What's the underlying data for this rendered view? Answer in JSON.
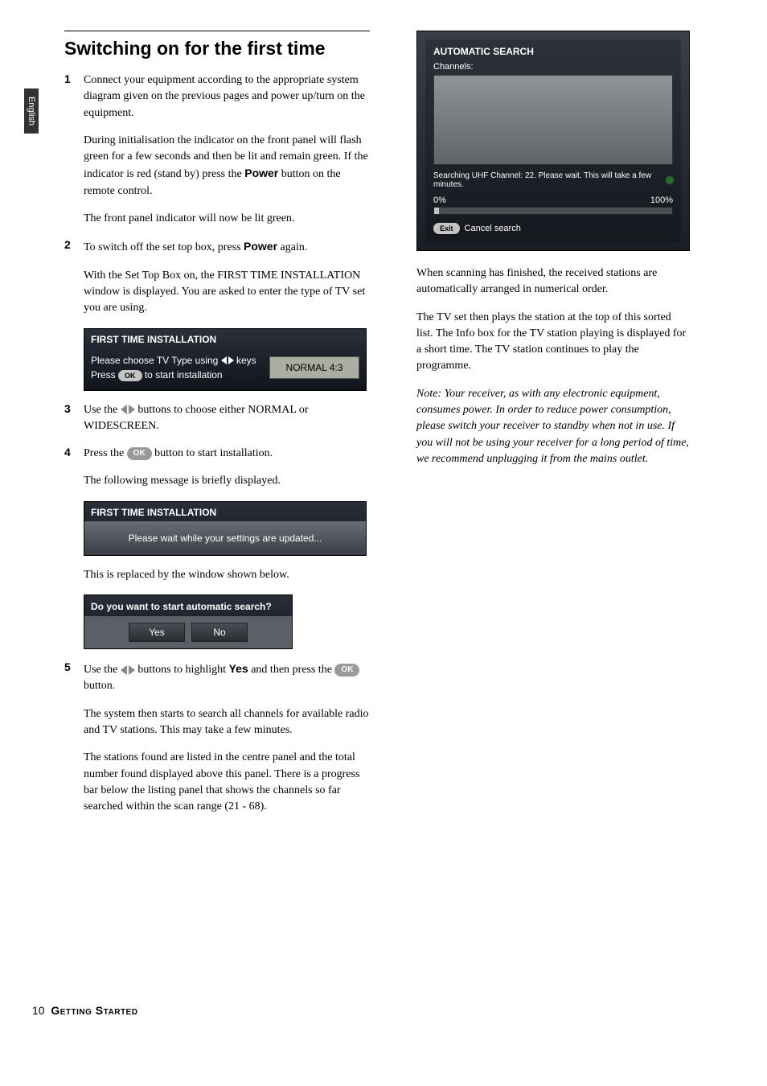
{
  "lang_tab": "English",
  "section_title": "Switching on for the first time",
  "steps": {
    "s1": {
      "num": "1",
      "p1a": "Connect your equipment according to the appropriate system diagram given on the previous pages and power up/turn on the equipment.",
      "p1b_pre": "During initialisation the indicator on the front panel will flash green for a few seconds and then be lit and remain green. If the indicator is red (stand by) press the ",
      "p1b_bold": "Power",
      "p1b_post": " button on the remote control.",
      "p1c": "The front panel indicator will now be lit green."
    },
    "s2": {
      "num": "2",
      "p2a_pre": "To switch off the set top box, press ",
      "p2a_bold": "Power",
      "p2a_post": " again.",
      "p2b": "With the Set Top Box on, the FIRST TIME INSTALLATION window is displayed. You are asked to enter the type of TV set you are using."
    },
    "s3": {
      "num": "3",
      "p3_pre": "Use the ",
      "p3_post": " buttons to choose either NORMAL or WIDESCREEN."
    },
    "s4": {
      "num": "4",
      "p4a_pre": "Press the ",
      "p4a_post": " button to start installation.",
      "p4b": "The following message is briefly displayed."
    },
    "after4": "This is replaced by the window shown below.",
    "s5": {
      "num": "5",
      "p5a_pre": "Use the ",
      "p5a_mid": " buttons to highlight ",
      "p5a_bold": "Yes",
      "p5a_post": " and then press the ",
      "p5a_end": " button.",
      "p5b": "The system then starts to search all channels for available radio and TV stations. This may take a few minutes.",
      "p5c": "The stations found are listed in the centre panel and the total number found displayed above this panel. There is a progress bar below the listing panel that shows the channels so far searched within the scan range (21 - 68)."
    }
  },
  "osd1": {
    "title": "FIRST TIME INSTALLATION",
    "line1_pre": "Please choose TV Type using ",
    "line1_post": " keys",
    "line2_pre": "Press ",
    "line2_post": " to start installation",
    "field": "NORMAL 4:3"
  },
  "osd2": {
    "title": "FIRST TIME INSTALLATION",
    "body": "Please wait while your settings are updated..."
  },
  "osd3": {
    "title": "Do you want to start automatic search?",
    "yes": "Yes",
    "no": "No"
  },
  "osd_big": {
    "title": "AUTOMATIC SEARCH",
    "channels_label": "Channels:",
    "status": "Searching UHF Channel: 22. Please wait. This will take a few minutes.",
    "pct0": "0%",
    "pct100": "100%",
    "exit_pill": "Exit",
    "exit_label": "Cancel search"
  },
  "pill_ok": "OK",
  "right": {
    "p1": "When scanning has finished, the received stations are automatically arranged in numerical order.",
    "p2": "The TV set then plays the station at the top of this sorted list. The Info box for the TV station playing is displayed for a short time. The TV station continues to play the programme.",
    "note": "Note:  Your receiver, as with any electronic equipment, consumes power. In order to reduce power consumption, please switch your receiver to standby when not in use. If you will not be using your receiver for a long period of time, we recommend unplugging it from the mains outlet."
  },
  "footer": {
    "page": "10",
    "section": "Getting Started"
  }
}
